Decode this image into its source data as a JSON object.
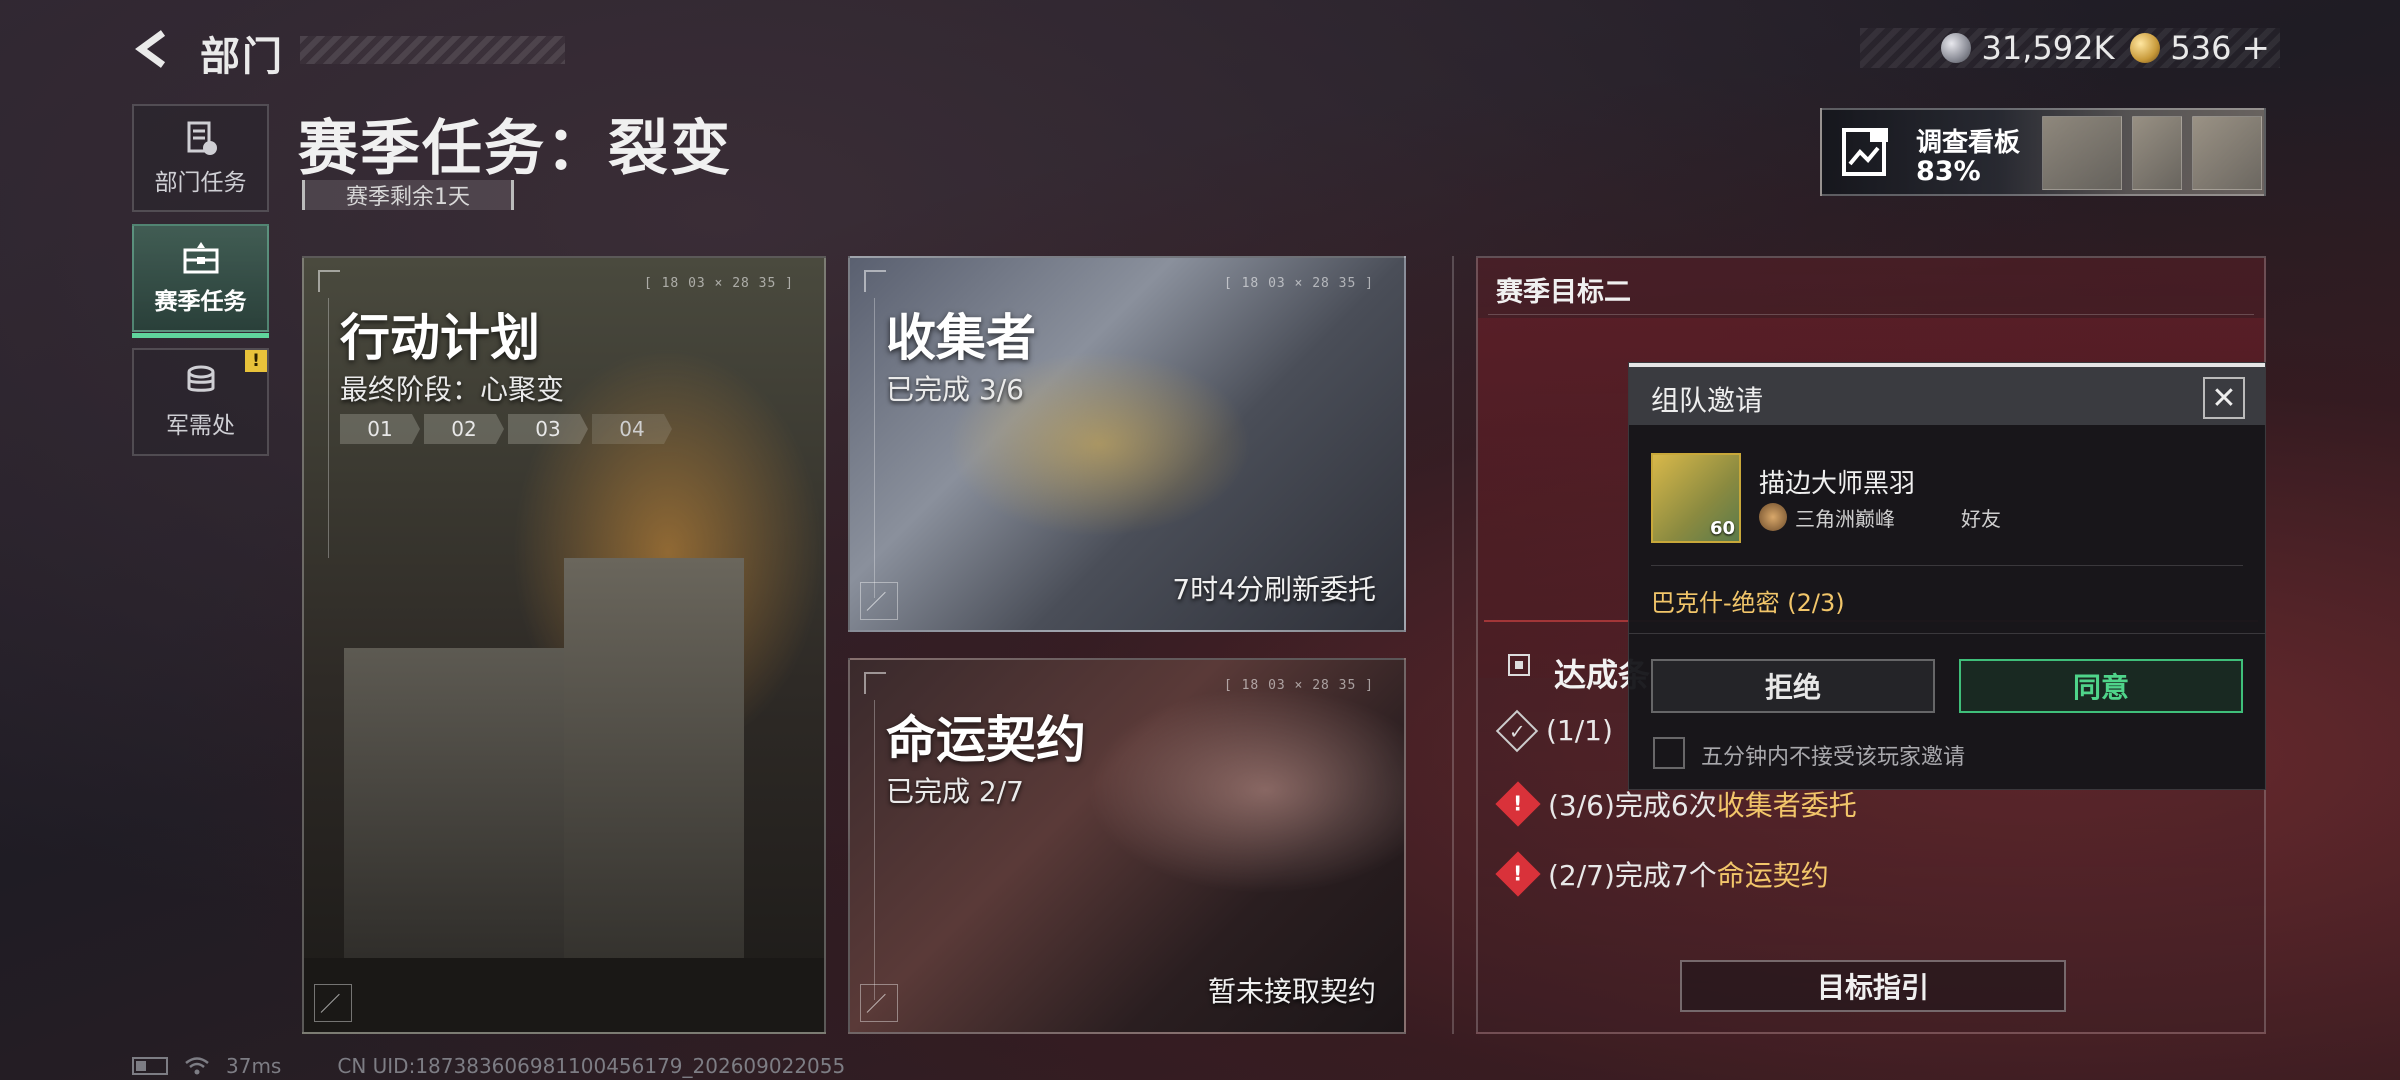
{
  "header": {
    "title": "部门"
  },
  "currency": {
    "silver_amount": "31,592K",
    "gold_amount": "536",
    "plus_label": "+",
    "silver_icon": "silver-coin-icon",
    "gold_icon": "gold-coin-icon"
  },
  "sidebar": {
    "items": [
      {
        "label": "部门任务",
        "icon": "task-list-icon",
        "active": false
      },
      {
        "label": "赛季任务",
        "icon": "briefcase-icon",
        "active": true
      },
      {
        "label": "军需处",
        "icon": "coin-stack-icon",
        "active": false,
        "badge": "!"
      }
    ]
  },
  "season": {
    "title": "赛季任务：裂变",
    "remaining": "赛季剩余1天"
  },
  "board": {
    "title": "调查看板",
    "progress": "83%"
  },
  "cards": {
    "action": {
      "title": "行动计划",
      "subtitle": "最终阶段：心聚变",
      "stages": [
        "01",
        "02",
        "03",
        "04"
      ],
      "code": "[ 18 03 × 28 35 ]"
    },
    "collector": {
      "title": "收集者",
      "subtitle": "已完成 3/6",
      "status": "7时4分刷新委托",
      "code": "[ 18 03 × 28 35 ]"
    },
    "fate": {
      "title": "命运契约",
      "subtitle": "已完成 2/7",
      "status": "暂未接取契约",
      "code": "[ 18 03 × 28 35 ]"
    }
  },
  "objectives": {
    "title": "赛季目标二",
    "condition_title": "达成条",
    "rows": [
      {
        "progress": "(1/1)",
        "text": "",
        "highlight": "",
        "state": "done"
      },
      {
        "progress": "(3/6)",
        "text": "完成6次",
        "highlight": "收集者委托",
        "state": "pending"
      },
      {
        "progress": "(2/7)",
        "text": "完成7个",
        "highlight": "命运契约",
        "state": "pending"
      }
    ],
    "guide_button": "目标指引"
  },
  "invite": {
    "title": "组队邀请",
    "close_symbol": "✕",
    "player_name": "描边大师黑羽",
    "level": "60",
    "rank": "三角洲巅峰",
    "relation": "好友",
    "mode": "巴克什-绝密 (2/3)",
    "decline": "拒绝",
    "accept": "同意",
    "mute_label": "五分钟内不接受该玩家邀请"
  },
  "footer": {
    "ping": "37ms",
    "uid": "CN UID:18738360698110045​6179_202609022055"
  },
  "colors": {
    "accent_green": "#4fd48a",
    "highlight_gold": "#f2c66a",
    "warning_red": "#d9323a",
    "badge_yellow": "#e8c23a"
  }
}
